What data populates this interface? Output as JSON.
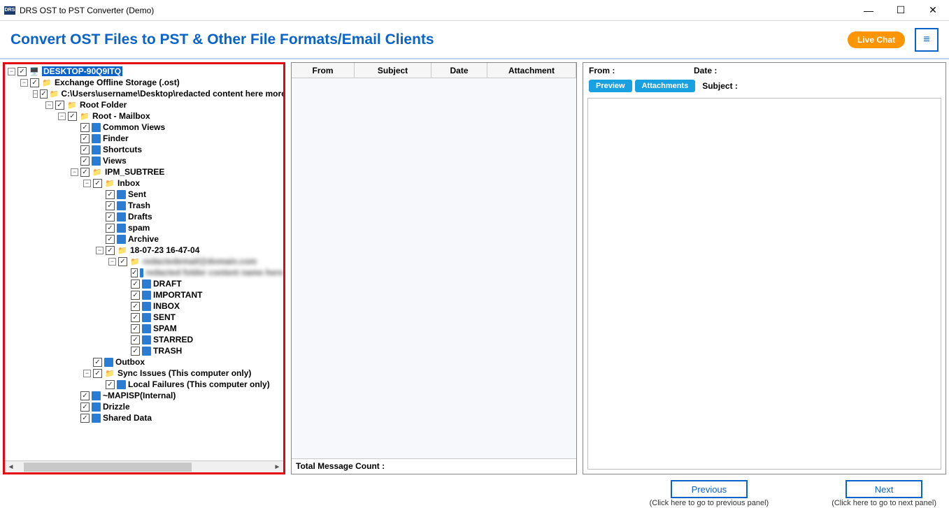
{
  "window": {
    "app_icon_text": "DRS",
    "title": "DRS OST to PST Converter (Demo)"
  },
  "header": {
    "heading": "Convert OST Files to PST & Other File Formats/Email Clients",
    "live_chat": "Live Chat"
  },
  "tree": {
    "root": "DESKTOP-90Q9ITQ",
    "exchange": "Exchange Offline Storage (.ost)",
    "path_prefix": "C:\\Users\\",
    "path_mid": "\\Desktop\\",
    "root_folder": "Root Folder",
    "root_mailbox": "Root - Mailbox",
    "common_views": "Common Views",
    "finder": "Finder",
    "shortcuts": "Shortcuts",
    "views": "Views",
    "ipm_subtree": "IPM_SUBTREE",
    "inbox": "Inbox",
    "sent": "Sent",
    "trash": "Trash",
    "drafts": "Drafts",
    "spam": "spam",
    "archive": "Archive",
    "ts_folder": "18-07-23 16-47-04",
    "draft_caps": "DRAFT",
    "important": "IMPORTANT",
    "inbox_caps": "INBOX",
    "sent_caps": "SENT",
    "spam_caps": "SPAM",
    "starred": "STARRED",
    "trash_caps": "TRASH",
    "outbox": "Outbox",
    "sync_issues": "Sync Issues (This computer only)",
    "local_failures": "Local Failures (This computer only)",
    "mapisp": "~MAPISP(Internal)",
    "drizzle": "Drizzle",
    "shared_data": "Shared Data"
  },
  "grid": {
    "from": "From",
    "subject": "Subject",
    "date": "Date",
    "attachment": "Attachment",
    "footer": "Total Message Count :"
  },
  "preview": {
    "from_label": "From :",
    "date_label": "Date :",
    "preview_btn": "Preview",
    "attachments_btn": "Attachments",
    "subject_label": "Subject :"
  },
  "footer": {
    "previous": "Previous",
    "previous_hint": "(Click here to go to previous panel)",
    "next": "Next",
    "next_hint": "(Click here to go to next panel)"
  }
}
